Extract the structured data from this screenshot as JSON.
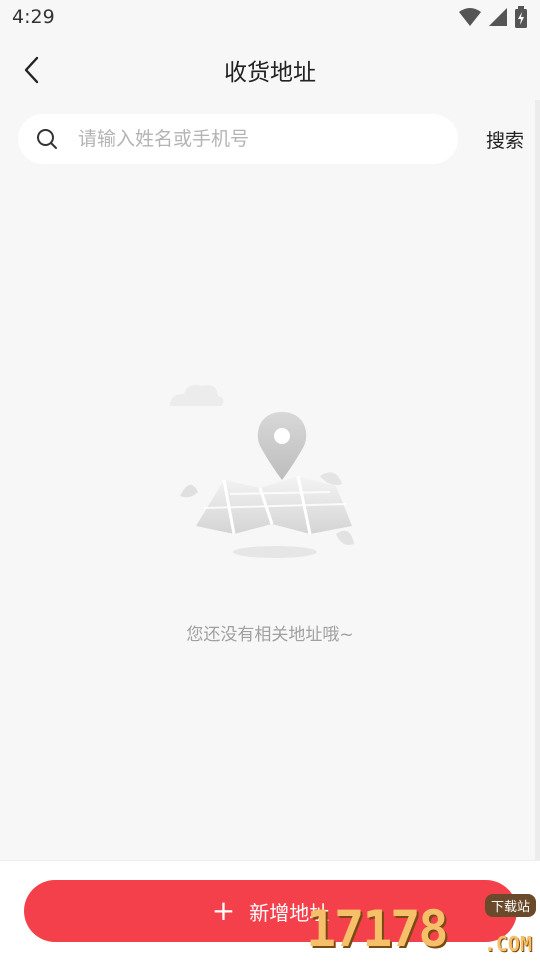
{
  "status_bar": {
    "time": "4:29",
    "icons": [
      "wifi-icon",
      "signal-icon",
      "battery-charging-icon"
    ]
  },
  "header": {
    "title": "收货地址",
    "back_icon": "chevron-left-icon"
  },
  "search": {
    "placeholder": "请输入姓名或手机号",
    "value": "",
    "button_label": "搜索",
    "icon": "search-icon"
  },
  "empty_state": {
    "illustration": "map-pin-illustration",
    "message": "您还没有相关地址哦~"
  },
  "footer": {
    "add_button_icon": "plus-icon",
    "add_button_label": "新增地址"
  },
  "watermark": {
    "digits": "17178",
    "suffix": ".COM",
    "tag": "下载站"
  },
  "colors": {
    "accent": "#f4404a",
    "background": "#f7f7f7",
    "placeholder": "#b4b4b4",
    "empty_text": "#a0a0a0"
  }
}
